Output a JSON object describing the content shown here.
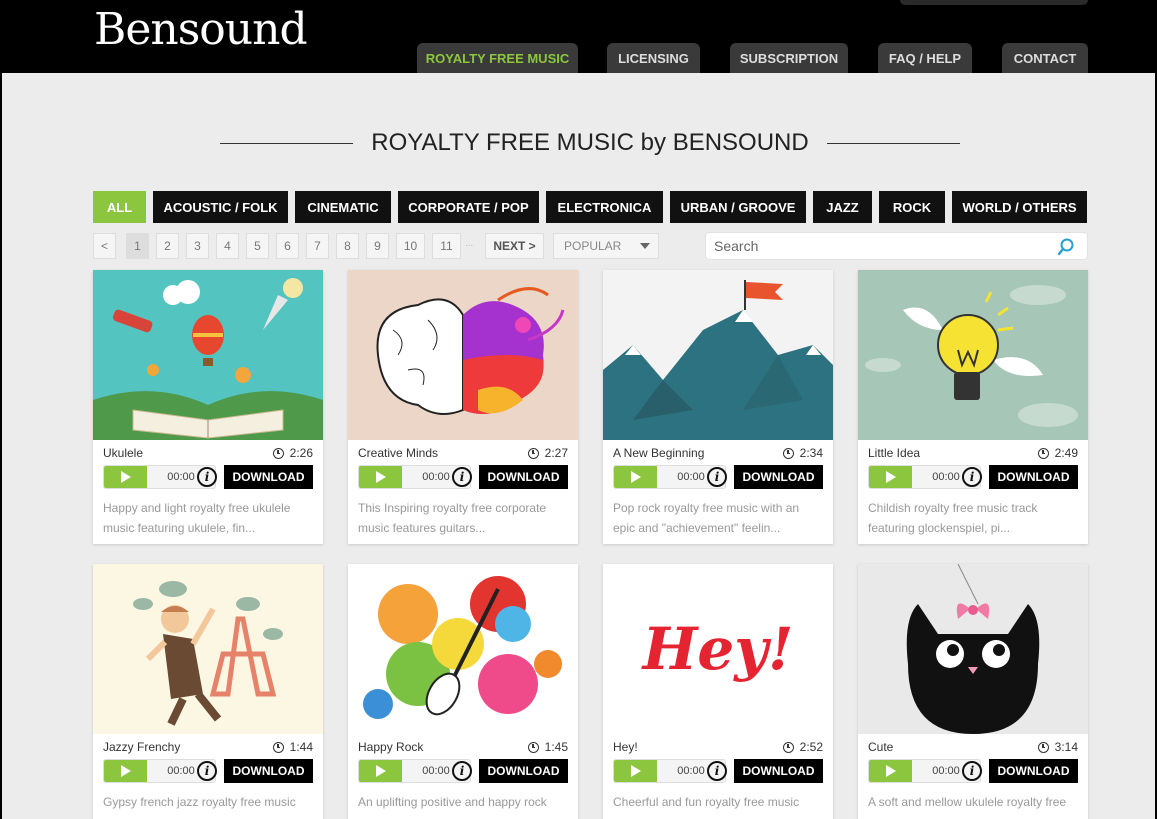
{
  "site": {
    "logo": "Bensound"
  },
  "nav": [
    {
      "label": "ROYALTY FREE MUSIC",
      "active": true
    },
    {
      "label": "LICENSING"
    },
    {
      "label": "SUBSCRIPTION"
    },
    {
      "label": "FAQ / HELP"
    },
    {
      "label": "CONTACT"
    }
  ],
  "page_title": "ROYALTY FREE MUSIC by BENSOUND",
  "genres": [
    "ALL",
    "ACOUSTIC / FOLK",
    "CINEMATIC",
    "CORPORATE / POP",
    "ELECTRONICA",
    "URBAN / GROOVE",
    "JAZZ",
    "ROCK",
    "WORLD / OTHERS"
  ],
  "active_genre": "ALL",
  "pagination": {
    "prev": "<",
    "pages": [
      "1",
      "2",
      "3",
      "4",
      "5",
      "6",
      "7",
      "8",
      "9",
      "10",
      "11"
    ],
    "current": "1",
    "ellipsis": "...",
    "next": "NEXT >"
  },
  "sort": {
    "selected": "POPULAR"
  },
  "search": {
    "placeholder": "Search"
  },
  "player": {
    "time": "00:00",
    "download_label": "DOWNLOAD",
    "info_label": "i"
  },
  "tracks": [
    {
      "title": "Ukulele",
      "duration": "2:26",
      "description": "Happy and light royalty free ukulele music featuring ukulele, fin...",
      "art": "book-balloon"
    },
    {
      "title": "Creative Minds",
      "duration": "2:27",
      "description": "This Inspiring royalty free corporate music features guitars...",
      "art": "colorful-brain"
    },
    {
      "title": "A New Beginning",
      "duration": "2:34",
      "description": "Pop rock royalty free music with an epic and \"achievement\" feelin...",
      "art": "mountain-flag"
    },
    {
      "title": "Little Idea",
      "duration": "2:49",
      "description": "Childish royalty free music track featuring glockenspiel, pi...",
      "art": "winged-lightbulb"
    },
    {
      "title": "Jazzy Frenchy",
      "duration": "1:44",
      "description": "Gypsy french jazz royalty free music",
      "art": "eiffel-tower-dancer"
    },
    {
      "title": "Happy Rock",
      "duration": "1:45",
      "description": "An uplifting positive and happy rock",
      "art": "paint-splash-guitar"
    },
    {
      "title": "Hey!",
      "duration": "2:52",
      "description": "Cheerful and fun royalty free music",
      "art": "hey-lettering"
    },
    {
      "title": "Cute",
      "duration": "3:14",
      "description": "A soft and mellow ukulele royalty free",
      "art": "black-cat-bow"
    }
  ],
  "colors": {
    "accent": "#8cc63f",
    "header": "#000000",
    "nav_tab": "#3a3a3a",
    "background": "#ececec"
  }
}
